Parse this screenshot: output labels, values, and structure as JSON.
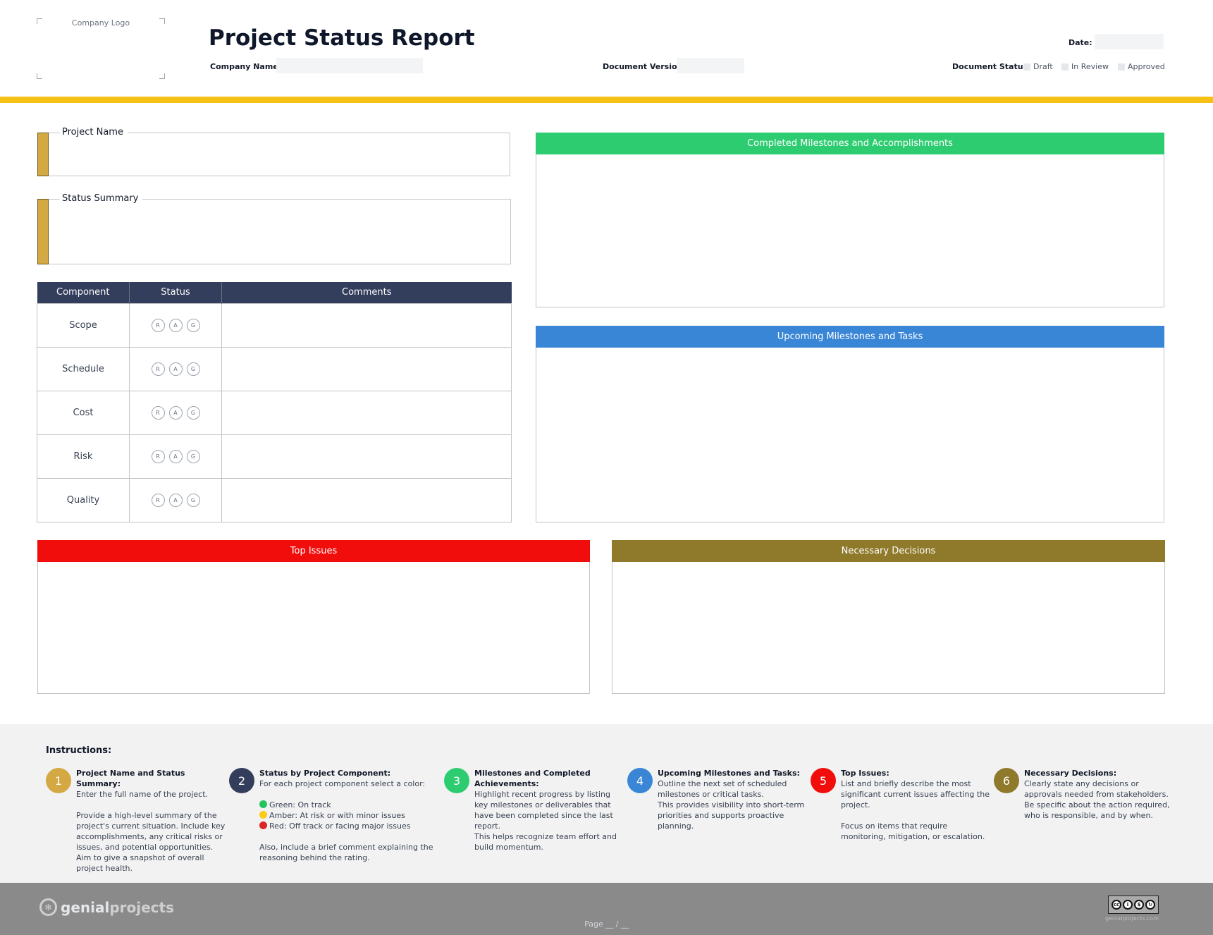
{
  "header": {
    "logo_placeholder": "Company Logo",
    "title": "Project Status Report",
    "date_label": "Date:",
    "company_name_label": "Company Name:",
    "document_version_label": "Document Version",
    "document_status_label": "Document Status:",
    "status_options": [
      "Draft",
      "In Review",
      "Approved"
    ]
  },
  "fields": {
    "project_name": "Project Name",
    "status_summary": "Status Summary"
  },
  "components_table": {
    "headers": [
      "Component",
      "Status",
      "Comments"
    ],
    "rows": [
      "Scope",
      "Schedule",
      "Cost",
      "Risk",
      "Quality"
    ],
    "rag": [
      "R",
      "A",
      "G"
    ]
  },
  "panels": {
    "completed": "Completed Milestones and Accomplishments",
    "upcoming": "Upcoming Milestones and Tasks",
    "issues": "Top Issues",
    "decisions": "Necessary Decisions"
  },
  "colors": {
    "accent_yellow": "#f5c116",
    "table_header": "#333d5c",
    "completed": "#2ecc71",
    "upcoming": "#3a86d6",
    "issues": "#f20d0d",
    "decisions": "#8f7a2b",
    "step1": "#d4a843",
    "step2": "#333d5c",
    "step3": "#2ecc71",
    "step4": "#3a86d6",
    "step5": "#f20d0d",
    "step6": "#8f7a2b"
  },
  "instructions": {
    "title": "Instructions:",
    "steps": [
      {
        "num": "1",
        "head": "Project Name and Status Summary:",
        "lines": [
          "Enter the full name of the project."
        ],
        "extra": "Provide a high-level summary of the project's current situation. Include key accomplishments, any critical risks or issues, and potential opportunities. Aim to give a snapshot of overall project health."
      },
      {
        "num": "2",
        "head": "Status by Project Component:",
        "lines": [
          "For each project component select a color:"
        ],
        "green": "Green: On track",
        "amber": "Amber: At risk or with minor issues",
        "red": "Red: Off track or facing major issues",
        "extra": "Also, include a brief comment explaining the reasoning behind the rating."
      },
      {
        "num": "3",
        "head": "Milestones and Completed Achievements:",
        "lines": [
          "Highlight recent progress by listing key milestones or deliverables that have been completed since the last report.",
          "This helps recognize team effort and build momentum."
        ]
      },
      {
        "num": "4",
        "head": "Upcoming Milestones and Tasks:",
        "lines": [
          "Outline the next set of scheduled milestones or critical tasks.",
          "This provides visibility into short-term priorities and supports proactive planning."
        ]
      },
      {
        "num": "5",
        "head": "Top Issues:",
        "lines": [
          "List and briefly describe the most significant current issues affecting the project."
        ],
        "extra": "Focus on items that require monitoring, mitigation, or escalation."
      },
      {
        "num": "6",
        "head": "Necessary Decisions:",
        "lines": [
          "Clearly state any decisions or approvals needed from stakeholders.",
          "Be specific about the action required, who is responsible, and by when."
        ]
      }
    ]
  },
  "footer": {
    "brand_part1": "genial",
    "brand_part2": "projects",
    "page": "Page __ / __",
    "license_url": "genialprojects.com"
  }
}
